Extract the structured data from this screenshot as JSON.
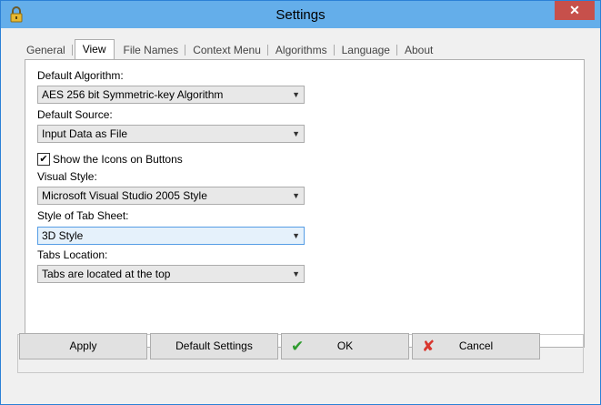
{
  "window": {
    "title": "Settings",
    "close_glyph": "✕"
  },
  "tabs": [
    {
      "label": "General"
    },
    {
      "label": "View"
    },
    {
      "label": "File Names"
    },
    {
      "label": "Context Menu"
    },
    {
      "label": "Algorithms"
    },
    {
      "label": "Language"
    },
    {
      "label": "About"
    }
  ],
  "form": {
    "default_algorithm_label": "Default Algorithm:",
    "default_algorithm_value": "AES 256 bit Symmetric-key Algorithm",
    "default_source_label": "Default Source:",
    "default_source_value": "Input Data as File",
    "show_icons_label": "Show the Icons on Buttons",
    "show_icons_checked": true,
    "visual_style_label": "Visual Style:",
    "visual_style_value": "Microsoft Visual Studio 2005 Style",
    "tab_sheet_label": "Style of Tab Sheet:",
    "tab_sheet_value": "3D Style",
    "tabs_location_label": "Tabs Location:",
    "tabs_location_value": "Tabs are located at the top"
  },
  "buttons": {
    "apply": "Apply",
    "default_settings": "Default Settings",
    "ok": "OK",
    "cancel": "Cancel"
  },
  "icons": {
    "app": "lock-icon",
    "ok": "checkmark-icon",
    "cancel": "x-icon"
  },
  "colors": {
    "titlebar": "#64aeea",
    "close": "#c7504b",
    "ok_icon": "#2e9b2e",
    "cancel_icon": "#d9362e"
  }
}
